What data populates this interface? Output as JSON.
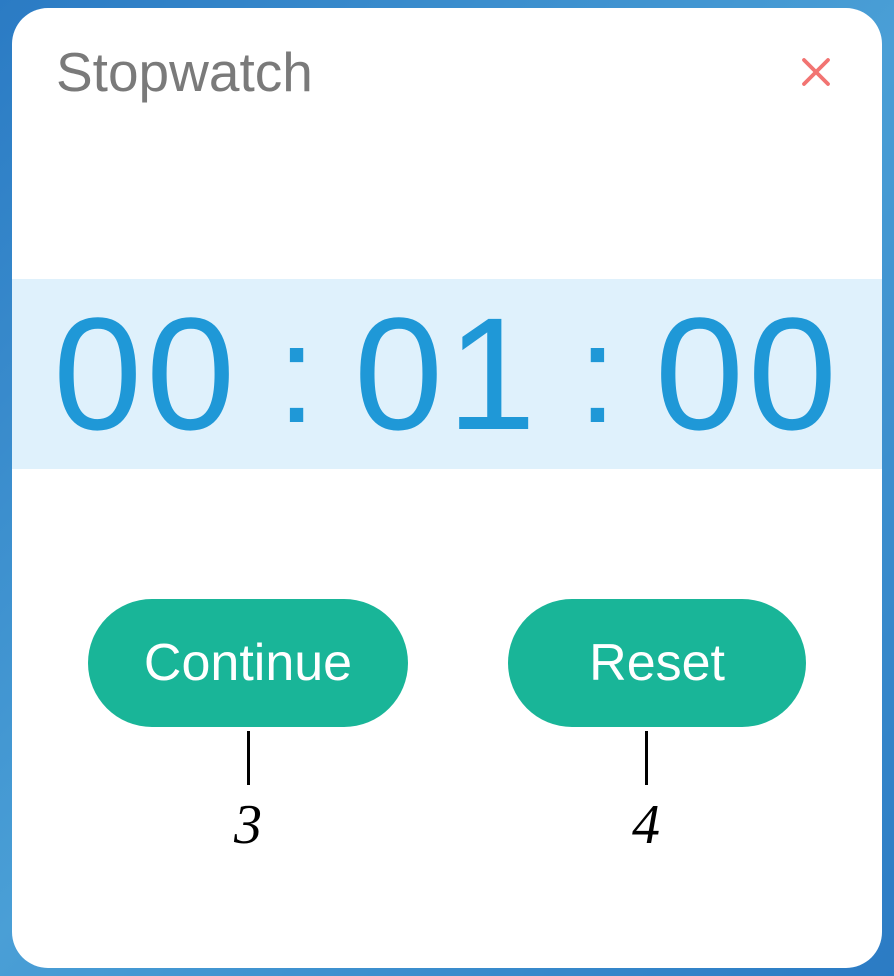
{
  "header": {
    "title": "Stopwatch"
  },
  "time": {
    "hours": "00",
    "minutes": "01",
    "seconds": "00",
    "separator": ":"
  },
  "buttons": {
    "continue_label": "Continue",
    "reset_label": "Reset"
  },
  "annotations": {
    "continue_number": "3",
    "reset_number": "4"
  },
  "colors": {
    "accent": "#1F98D7",
    "button": "#19B598",
    "close": "#F27472",
    "time_bg": "#DFF1FC"
  }
}
